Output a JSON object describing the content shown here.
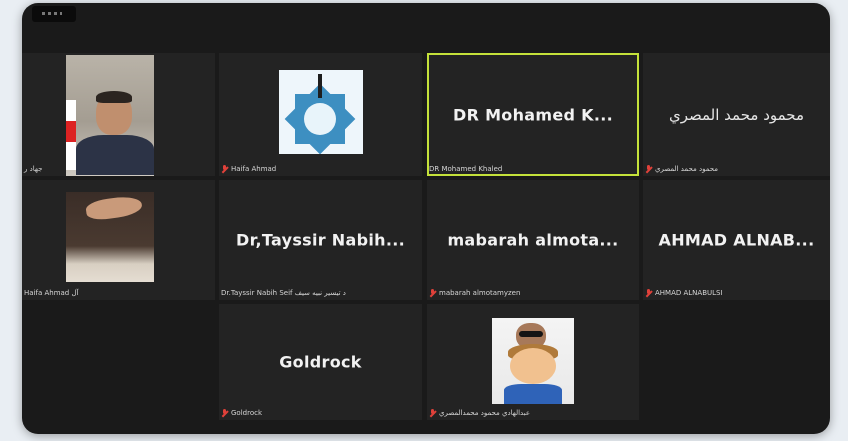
{
  "meeting": {
    "participants": [
      {
        "id": "p1",
        "name": "جهاد ر",
        "display": "",
        "type": "video"
      },
      {
        "id": "p2",
        "name": "Haifa Ahmad",
        "display": "",
        "type": "image",
        "muted": true
      },
      {
        "id": "p3",
        "name": "DR Mohamed Khaled",
        "display": "DR Mohamed K...",
        "type": "name",
        "speaking": true
      },
      {
        "id": "p4",
        "name": "محمود محمد المصري",
        "display": "محمود محمد المصري",
        "type": "name",
        "muted": true
      },
      {
        "id": "p5",
        "name": "Haifa Ahmad آل",
        "display": "",
        "type": "video"
      },
      {
        "id": "p6",
        "name": "Dr.Tayssir Nabih Seif د تيسير نبيه سيف",
        "display": "Dr,Tayssir  Nabih...",
        "type": "name"
      },
      {
        "id": "p7",
        "name": "mabarah almotamyzen",
        "display": "mabarah  almota...",
        "type": "name",
        "muted": true
      },
      {
        "id": "p8",
        "name": "AHMAD ALNABULSI",
        "display": "AHMAD  ALNAB...",
        "type": "name",
        "muted": true
      },
      {
        "id": "p9",
        "name": "Goldrock",
        "display": "Goldrock",
        "type": "name",
        "muted": true
      },
      {
        "id": "p10",
        "name": "عبدالهادي محمود محمدالمصري",
        "display": "",
        "type": "video",
        "muted": true
      }
    ]
  },
  "colors": {
    "active_speaker": "#c4e13a",
    "tile_bg": "#232323",
    "frame_bg": "#1a1a1a",
    "muted_icon": "#e0413a"
  },
  "icons": {
    "muted": "mic-muted-icon"
  }
}
